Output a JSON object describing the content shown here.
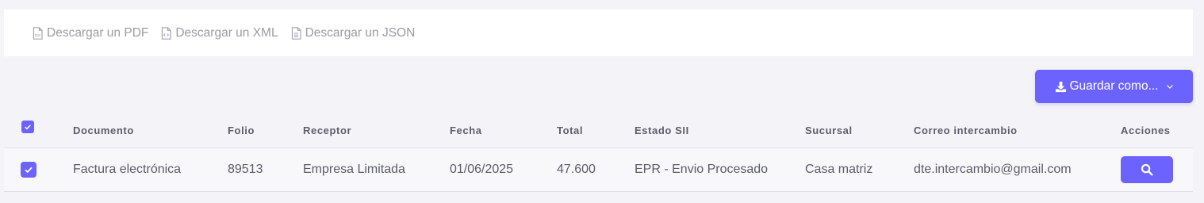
{
  "downloads": {
    "pdf_label": "Descargar un PDF",
    "xml_label": "Descargar un XML",
    "json_label": "Descargar un JSON"
  },
  "toolbar": {
    "save_label": "Guardar como..."
  },
  "table": {
    "headers": {
      "documento": "Documento",
      "folio": "Folio",
      "receptor": "Receptor",
      "fecha": "Fecha",
      "total": "Total",
      "estado": "Estado SII",
      "sucursal": "Sucursal",
      "correo": "Correo intercambio",
      "acciones": "Acciones"
    },
    "rows": [
      {
        "selected": true,
        "documento": "Factura electrónica",
        "folio": "89513",
        "receptor": "Empresa Limitada",
        "fecha": "01/06/2025",
        "total": "47.600",
        "estado": "EPR - Envio Procesado",
        "sucursal": "Casa matriz",
        "correo": "dte.intercambio@gmail.com"
      }
    ]
  },
  "icons": {
    "pdf": "file-pdf-icon",
    "xml": "file-code-icon",
    "json": "file-text-icon",
    "save": "download-icon",
    "chevron": "chevron-down-icon",
    "search": "search-icon",
    "check": "check-icon"
  },
  "colors": {
    "accent": "#6c63ff",
    "background": "#f4f3f8",
    "link": "#9b9ba8"
  }
}
